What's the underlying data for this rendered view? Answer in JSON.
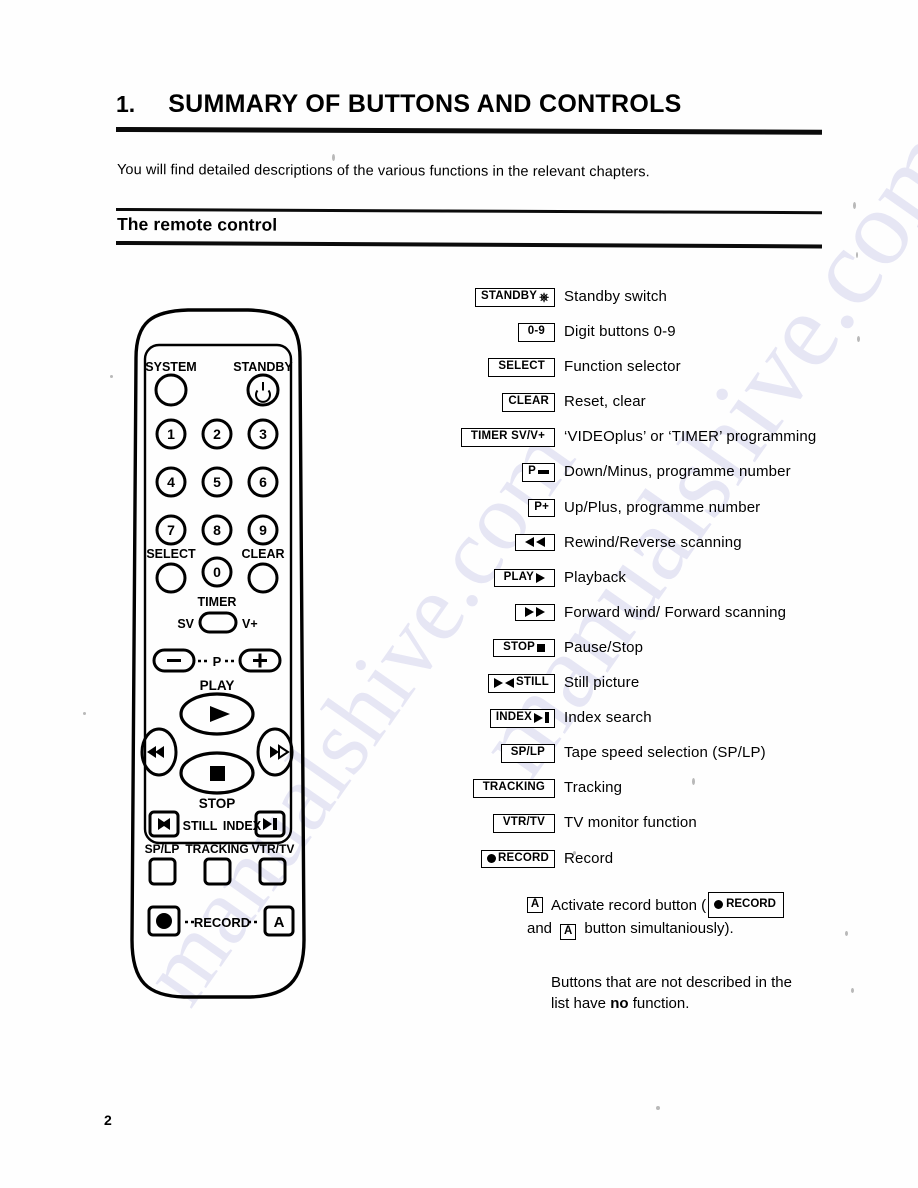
{
  "document": {
    "chapter_number": "1.",
    "chapter_title": "SUMMARY OF BUTTONS AND CONTROLS",
    "intro_text": "You will find detailed descriptions of the various functions in the relevant chapters.",
    "section_heading": "The remote control",
    "page_number": "2",
    "watermark_text": "manualshive.com"
  },
  "remote": {
    "labels": {
      "system": "SYSTEM",
      "standby": "STANDBY",
      "select": "SELECT",
      "clear": "CLEAR",
      "timer": "TIMER",
      "sv": "SV",
      "v_plus": "V+",
      "p": "P",
      "minus": "–",
      "plus": "+",
      "play": "PLAY",
      "stop": "STOP",
      "still": "STILL",
      "index": "INDEX",
      "sp_lp": "SP/LP",
      "tracking": "TRACKING",
      "vtr_tv": "VTR/TV",
      "record": "RECORD",
      "a_button": "A"
    },
    "digits": [
      "1",
      "2",
      "3",
      "4",
      "5",
      "6",
      "7",
      "8",
      "9",
      "0"
    ]
  },
  "legend": {
    "items": [
      {
        "key": "STANDBY",
        "glyph": "power",
        "desc": "Standby switch"
      },
      {
        "key": "0-9",
        "glyph": "",
        "desc": "Digit buttons 0-9"
      },
      {
        "key": "SELECT",
        "glyph": "",
        "desc": "Function selector"
      },
      {
        "key": "CLEAR",
        "glyph": "",
        "desc": "Reset, clear"
      },
      {
        "key": "TIMER SV/V+",
        "glyph": "",
        "desc": "‘VIDEOplus’ or ‘TIMER’ programming"
      },
      {
        "key": "P",
        "glyph": "minus",
        "desc": "Down/Minus, programme number"
      },
      {
        "key": "P+",
        "glyph": "",
        "desc": "Up/Plus, programme number"
      },
      {
        "key": "",
        "glyph": "rewind",
        "desc": "Rewind/Reverse scanning"
      },
      {
        "key": "PLAY",
        "glyph": "play",
        "desc": "Playback"
      },
      {
        "key": "",
        "glyph": "forward",
        "desc": "Forward wind/ Forward scanning"
      },
      {
        "key": "STOP",
        "glyph": "square",
        "desc": "Pause/Stop"
      },
      {
        "key": "STILL",
        "glyph": "still",
        "desc": "Still picture"
      },
      {
        "key": "INDEX",
        "glyph": "index",
        "desc": "Index search"
      },
      {
        "key": "SP/LP",
        "glyph": "",
        "desc": "Tape speed selection (SP/LP)"
      },
      {
        "key": "TRACKING",
        "glyph": "",
        "desc": "Tracking"
      },
      {
        "key": "VTR/TV",
        "glyph": "",
        "desc": "TV monitor function"
      },
      {
        "key": "RECORD",
        "glyph": "record",
        "desc": "Record"
      }
    ]
  },
  "notes": {
    "activate_prefix": "Activate record button (",
    "activate_record_key": "RECORD",
    "activate_mid": "and",
    "activate_a": "A",
    "activate_suffix": "button simultaniously).",
    "boxed_a": "A",
    "final_line1": "Buttons that are not described in the",
    "final_line2_pre": "list have ",
    "final_line2_bold": "no",
    "final_line2_post": " function."
  }
}
